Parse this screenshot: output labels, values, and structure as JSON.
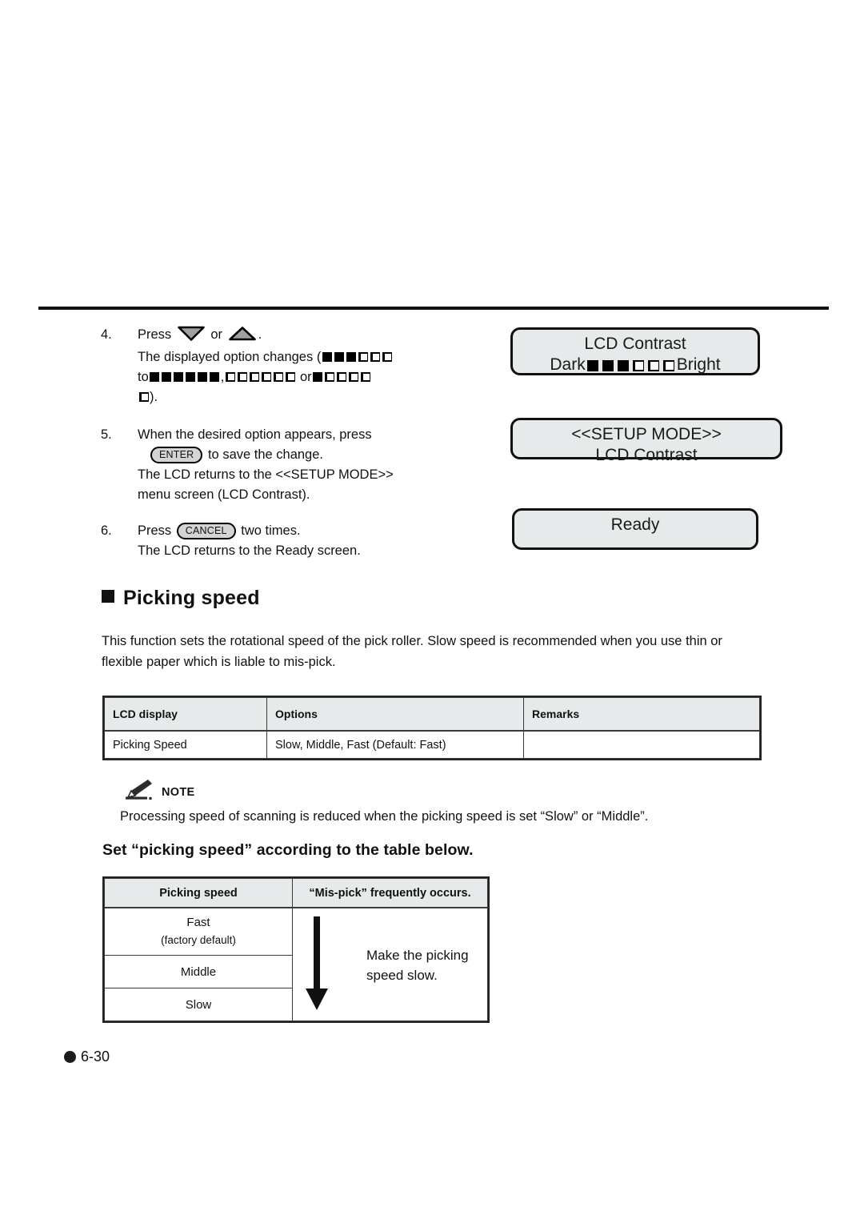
{
  "page": {
    "footer_page_number": "6-30"
  },
  "steps": [
    {
      "number": "4.",
      "lines": [
        "Press  ▽  or  △ .",
        "The displayed option changes (■ ■ ■ ❑ ❑ ❑",
        "to ■ ■ ■ ■ ■ ■, ❑ ❑ ❑ ❑ ❑ ❑ or ■ ❑ ❑ ❑ ❑",
        "❑)."
      ],
      "text_press": "Press",
      "text_or": "or",
      "text_period": ".",
      "text_changes_prefix": "The displayed option changes (",
      "text_to": "to",
      "text_comma": ",",
      "text_or2": "or",
      "text_close": ")."
    },
    {
      "number": "5.",
      "line1": "When the desired option appears, press",
      "key_label": "ENTER",
      "line2_after_key": "to save the change.",
      "line3": "The LCD returns to the <<SETUP MODE>>",
      "line4": "menu screen (LCD Contrast)."
    },
    {
      "number": "6.",
      "line1_before_key": "Press",
      "key_label": "CANCEL",
      "line1_after_key": "two times.",
      "line2": "The LCD returns to the Ready screen."
    }
  ],
  "lcd_screens": [
    {
      "name": "lcd-contrast-bar",
      "line1": "LCD Contrast",
      "label_left": "Dark",
      "label_right": "Bright",
      "filled_blocks": 3,
      "open_blocks": 3
    },
    {
      "name": "setup-mode-menu",
      "line1": "<<SETUP MODE>>",
      "line2": "LCD Contrast"
    },
    {
      "name": "ready-screen",
      "line1": "Ready"
    }
  ],
  "section": {
    "heading": "Picking speed",
    "paragraph": "This function sets the rotational speed of the pick roller.  Slow speed is recommended when you use thin or flexible paper which is liable to mis-pick."
  },
  "table_options": {
    "headers": [
      "LCD display",
      "Options",
      "Remarks"
    ],
    "rows": [
      [
        "Picking Speed",
        "Slow, Middle, Fast (Default: Fast)",
        ""
      ]
    ]
  },
  "note": {
    "label": "NOTE",
    "text": "Processing speed of scanning is reduced when the picking speed is set “Slow” or “Middle”."
  },
  "subheading": "Set “picking speed” according to the table below.",
  "table_speed": {
    "headers": [
      "Picking speed",
      "“Mis-pick” frequently occurs."
    ],
    "rows": [
      {
        "speed": "Fast",
        "sub": "(factory default)"
      },
      {
        "speed": "Middle",
        "sub": ""
      },
      {
        "speed": "Slow",
        "sub": ""
      }
    ],
    "annotation_line1": "Make the picking",
    "annotation_line2": "speed slow."
  },
  "colors": {
    "lcd_fill": "#e6eaea",
    "table_header_fill": "#e6eaea",
    "ink": "#111111",
    "key_fill": "#d4d4d4"
  }
}
